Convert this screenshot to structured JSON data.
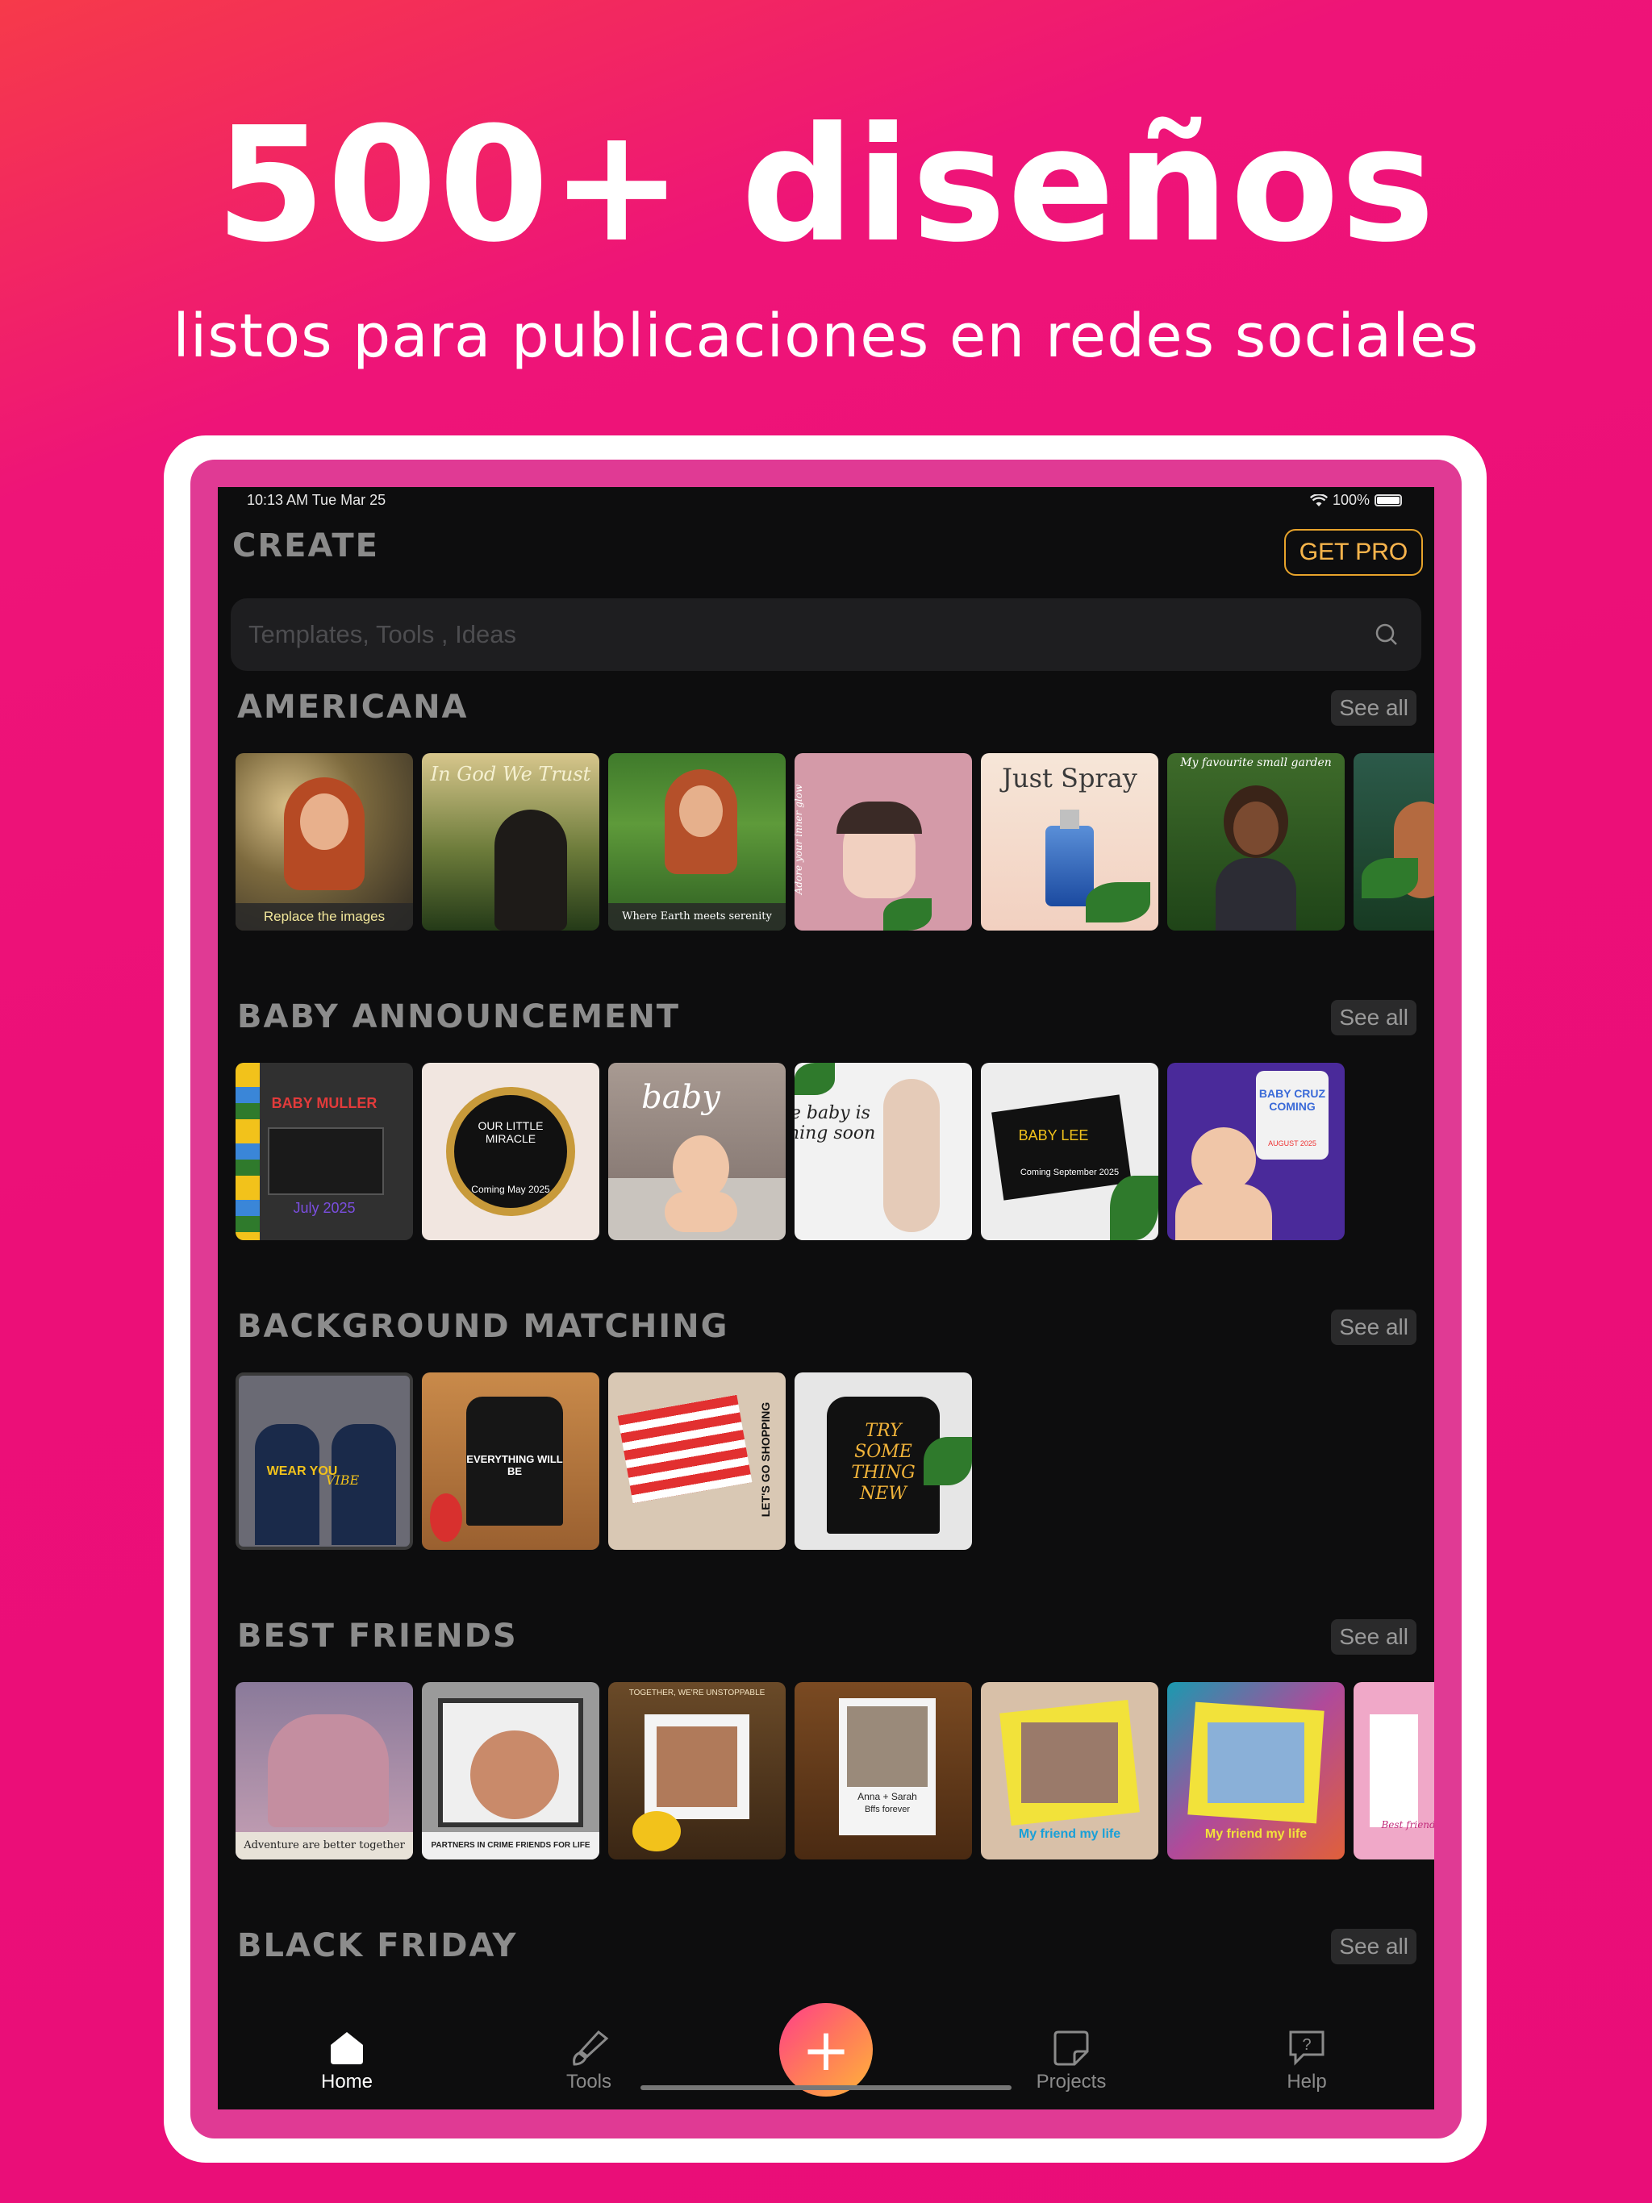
{
  "promo": {
    "headline": "500+ diseños",
    "subline": "listos para publicaciones en redes sociales"
  },
  "status_bar": {
    "time": "10:13 AM   Tue Mar 25",
    "battery": "100%"
  },
  "header": {
    "title": "CREATE",
    "get_pro_label": "GET PRO"
  },
  "search": {
    "placeholder": "Templates, Tools , Ideas"
  },
  "sections": [
    {
      "title": "AMERICANA",
      "see_all": "See all",
      "thumbs": [
        {
          "caption": "Replace the images"
        },
        {
          "overlay": "In God We Trust"
        },
        {
          "caption": "Where Earth meets serenity"
        },
        {
          "overlay": "Adore your inner glow"
        },
        {
          "overlay": "Just Spray"
        },
        {
          "overlay": "My favourite small garden"
        },
        {
          "overlay": ""
        }
      ]
    },
    {
      "title": "BABY ANNOUNCEMENT",
      "see_all": "See all",
      "thumbs": [
        {
          "overlay": "BABY MULLER",
          "overlay2": "July 2025"
        },
        {
          "overlay": "OUR LITTLE MIRACLE",
          "overlay2": "Coming May 2025"
        },
        {
          "overlay": "baby"
        },
        {
          "overlay": "The baby is coming soon"
        },
        {
          "overlay": "BABY LEE",
          "overlay2": "Coming September 2025"
        },
        {
          "overlay": "BABY CRUZ COMING",
          "overlay2": "AUGUST 2025"
        }
      ]
    },
    {
      "title": "BACKGROUND MATCHING",
      "see_all": "See all",
      "thumbs": [
        {
          "overlay": "WEAR YOU",
          "overlay2": "VIBE"
        },
        {
          "overlay": "EVERYTHING WILL BE"
        },
        {
          "overlay": "LET'S GO SHOPPING"
        },
        {
          "overlay": "TRY SOME THING NEW"
        }
      ]
    },
    {
      "title": "BEST FRIENDS",
      "see_all": "See all",
      "thumbs": [
        {
          "caption": "Adventure are better together"
        },
        {
          "caption": "PARTNERS IN CRIME FRIENDS FOR LIFE"
        },
        {
          "overlay": "TOGETHER, WE'RE UNSTOPPABLE"
        },
        {
          "overlay": "Anna + Sarah",
          "overlay2": "Bffs forever"
        },
        {
          "overlay": "My friend my life"
        },
        {
          "overlay": "My friend my life"
        },
        {
          "overlay": "Best friend is"
        }
      ]
    },
    {
      "title": "BLACK FRIDAY",
      "see_all": "See all",
      "thumbs": []
    }
  ],
  "tabbar": {
    "home": "Home",
    "tools": "Tools",
    "add": "+",
    "projects": "Projects",
    "help": "Help"
  },
  "colors": {
    "background": "#ec0f78",
    "frame_inner": "#e03a94",
    "screen": "#0d0d0e",
    "accent_gold": "#f2b43a"
  }
}
